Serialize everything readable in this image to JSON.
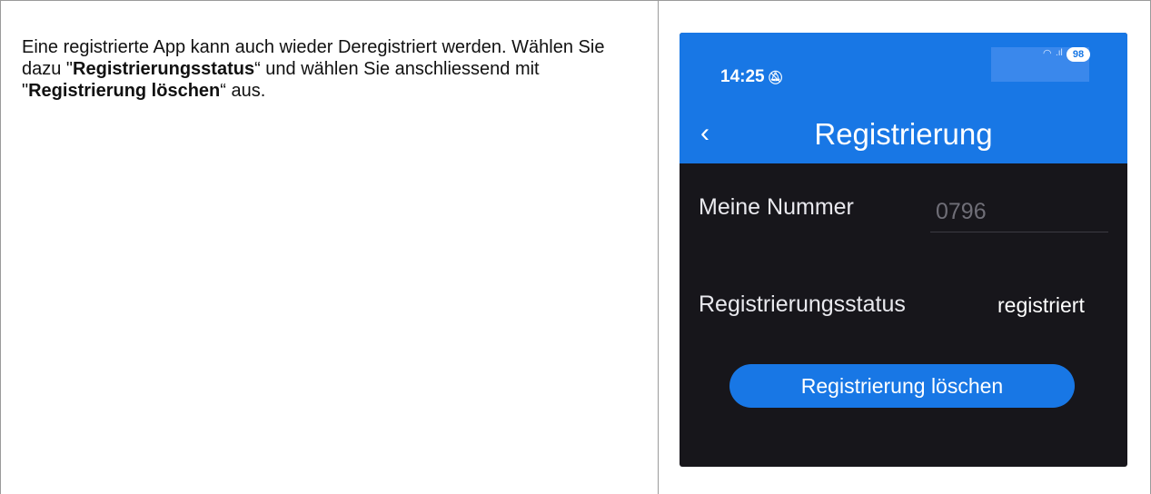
{
  "instruction": {
    "part1": "Eine registrierte App kann auch wieder Deregistriert werden. Wählen Sie dazu \"",
    "bold1": "Registrierungsstatus",
    "part2": "“ und wählen Sie anschliessend mit \"",
    "bold2": "Registrierung löschen",
    "part3": "“ aus."
  },
  "phone": {
    "status_bar": {
      "time": "14:25",
      "battery": "98",
      "icons": [
        "bell-muted-icon",
        "wifi-icon",
        "signal-icon",
        "battery-badge"
      ]
    },
    "nav": {
      "back_icon": "chevron-left-icon",
      "title": "Registrierung"
    },
    "number_label": "Meine Nummer",
    "number_value": "0796",
    "status_label": "Registrierungsstatus",
    "status_value": "registriert",
    "delete_button": "Registrierung löschen",
    "colors": {
      "accent": "#1877e5",
      "background": "#17161b"
    }
  }
}
